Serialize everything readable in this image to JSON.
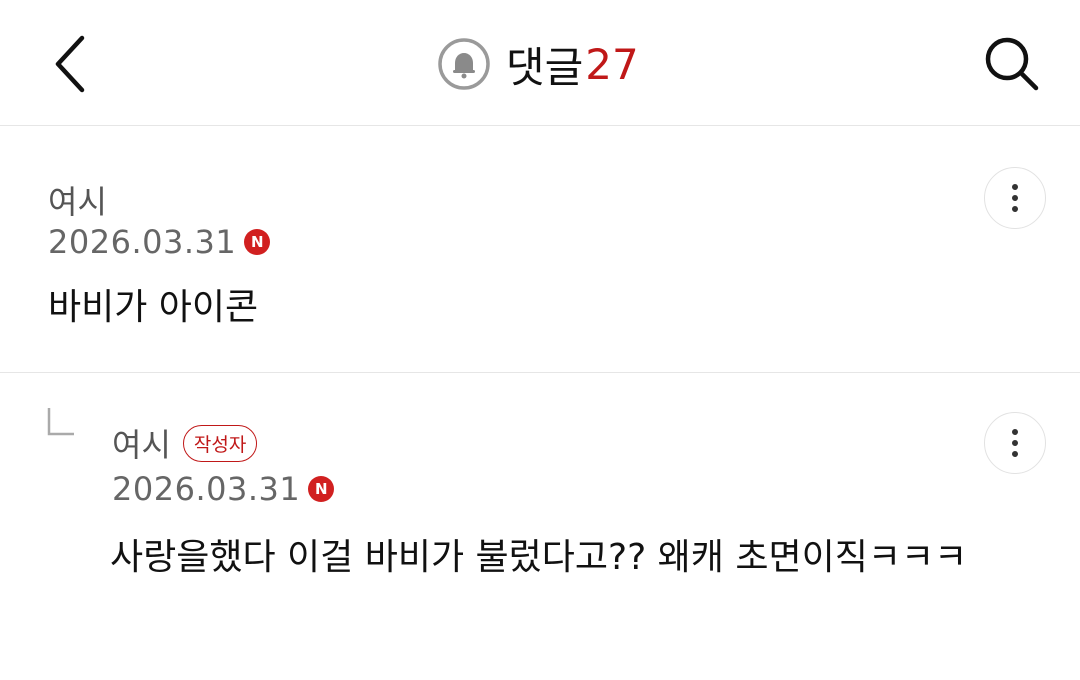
{
  "header": {
    "title": "댓글",
    "count": "27"
  },
  "icons": {
    "back": "chevron-left-icon",
    "bell": "bell-icon",
    "search": "search-icon",
    "more": "more-vertical-icon",
    "reply": "reply-arrow-icon",
    "new": "new-badge-icon"
  },
  "colors": {
    "accent": "#c01818",
    "new_badge": "#d12020",
    "text": "#111111",
    "meta": "#666666"
  },
  "comments": [
    {
      "author": "여시",
      "date": "2026.03.31",
      "new_badge": "N",
      "body": "바비가 아이콘"
    },
    {
      "author": "여시",
      "author_badge": "작성자",
      "date": "2026.03.31",
      "new_badge": "N",
      "body": "사랑을했다 이걸 바비가 불렀다고?? 왜캐 초면이직ㅋㅋㅋ"
    }
  ]
}
